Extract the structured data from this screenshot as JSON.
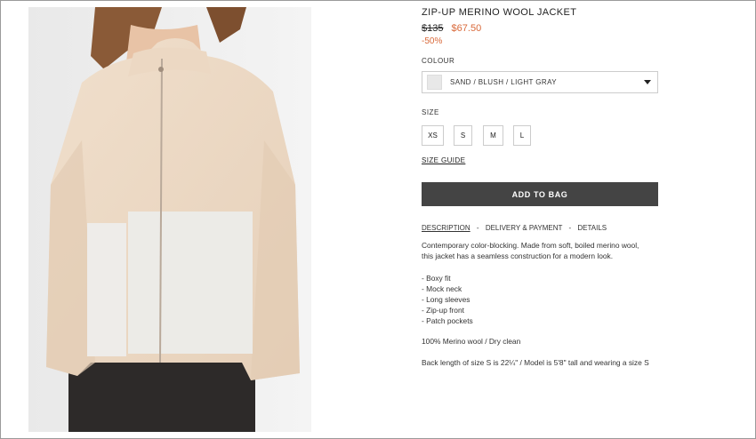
{
  "product": {
    "title": "ZIP-UP MERINO WOOL JACKET",
    "old_price": "$135",
    "sale_price": "$67.50",
    "discount": "-50%"
  },
  "colour": {
    "label": "COLOUR",
    "selected": "SAND / BLUSH / LIGHT GRAY",
    "swatch_color": "#e8e8e8"
  },
  "size": {
    "label": "SIZE",
    "options": [
      "XS",
      "S",
      "M",
      "L"
    ],
    "guide_label": "SIZE GUIDE"
  },
  "cart": {
    "add_label": "ADD TO BAG",
    "button_color": "#444444"
  },
  "tabs": [
    "DESCRIPTION",
    "DELIVERY & PAYMENT",
    "DETAILS"
  ],
  "tab_separator": "-",
  "description": {
    "line1": "Contemporary color-blocking. Made from soft, boiled merino wool,",
    "line2": "this jacket has a seamless construction for a modern look.",
    "bullets": [
      "- Boxy fit",
      "- Mock neck",
      "- Long sleeves",
      "- Zip-up front",
      "- Patch pockets"
    ],
    "material": "100% Merino wool / Dry clean",
    "length": "Back length of size S is 22¼\" / Model is 5'8\" tall and wearing a size S"
  },
  "colors": {
    "sale": "#d9693a"
  }
}
